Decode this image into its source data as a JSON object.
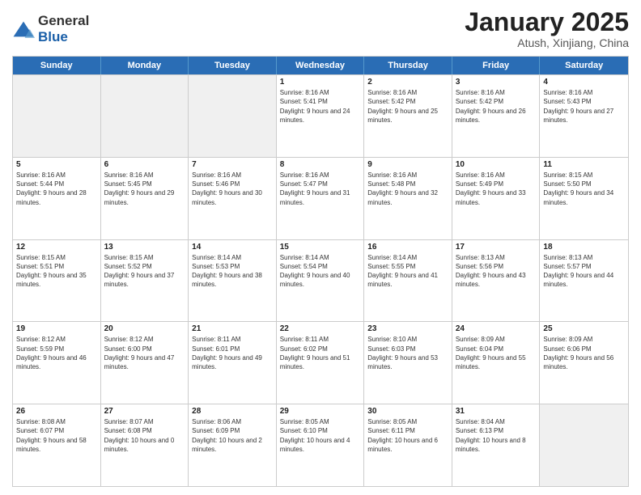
{
  "header": {
    "logo": {
      "general": "General",
      "blue": "Blue"
    },
    "month": "January 2025",
    "location": "Atush, Xinjiang, China"
  },
  "weekdays": [
    "Sunday",
    "Monday",
    "Tuesday",
    "Wednesday",
    "Thursday",
    "Friday",
    "Saturday"
  ],
  "rows": [
    [
      {
        "day": "",
        "sunrise": "",
        "sunset": "",
        "daylight": "",
        "shaded": true
      },
      {
        "day": "",
        "sunrise": "",
        "sunset": "",
        "daylight": "",
        "shaded": true
      },
      {
        "day": "",
        "sunrise": "",
        "sunset": "",
        "daylight": "",
        "shaded": true
      },
      {
        "day": "1",
        "sunrise": "Sunrise: 8:16 AM",
        "sunset": "Sunset: 5:41 PM",
        "daylight": "Daylight: 9 hours and 24 minutes."
      },
      {
        "day": "2",
        "sunrise": "Sunrise: 8:16 AM",
        "sunset": "Sunset: 5:42 PM",
        "daylight": "Daylight: 9 hours and 25 minutes."
      },
      {
        "day": "3",
        "sunrise": "Sunrise: 8:16 AM",
        "sunset": "Sunset: 5:42 PM",
        "daylight": "Daylight: 9 hours and 26 minutes."
      },
      {
        "day": "4",
        "sunrise": "Sunrise: 8:16 AM",
        "sunset": "Sunset: 5:43 PM",
        "daylight": "Daylight: 9 hours and 27 minutes."
      }
    ],
    [
      {
        "day": "5",
        "sunrise": "Sunrise: 8:16 AM",
        "sunset": "Sunset: 5:44 PM",
        "daylight": "Daylight: 9 hours and 28 minutes."
      },
      {
        "day": "6",
        "sunrise": "Sunrise: 8:16 AM",
        "sunset": "Sunset: 5:45 PM",
        "daylight": "Daylight: 9 hours and 29 minutes."
      },
      {
        "day": "7",
        "sunrise": "Sunrise: 8:16 AM",
        "sunset": "Sunset: 5:46 PM",
        "daylight": "Daylight: 9 hours and 30 minutes."
      },
      {
        "day": "8",
        "sunrise": "Sunrise: 8:16 AM",
        "sunset": "Sunset: 5:47 PM",
        "daylight": "Daylight: 9 hours and 31 minutes."
      },
      {
        "day": "9",
        "sunrise": "Sunrise: 8:16 AM",
        "sunset": "Sunset: 5:48 PM",
        "daylight": "Daylight: 9 hours and 32 minutes."
      },
      {
        "day": "10",
        "sunrise": "Sunrise: 8:16 AM",
        "sunset": "Sunset: 5:49 PM",
        "daylight": "Daylight: 9 hours and 33 minutes."
      },
      {
        "day": "11",
        "sunrise": "Sunrise: 8:15 AM",
        "sunset": "Sunset: 5:50 PM",
        "daylight": "Daylight: 9 hours and 34 minutes."
      }
    ],
    [
      {
        "day": "12",
        "sunrise": "Sunrise: 8:15 AM",
        "sunset": "Sunset: 5:51 PM",
        "daylight": "Daylight: 9 hours and 35 minutes."
      },
      {
        "day": "13",
        "sunrise": "Sunrise: 8:15 AM",
        "sunset": "Sunset: 5:52 PM",
        "daylight": "Daylight: 9 hours and 37 minutes."
      },
      {
        "day": "14",
        "sunrise": "Sunrise: 8:14 AM",
        "sunset": "Sunset: 5:53 PM",
        "daylight": "Daylight: 9 hours and 38 minutes."
      },
      {
        "day": "15",
        "sunrise": "Sunrise: 8:14 AM",
        "sunset": "Sunset: 5:54 PM",
        "daylight": "Daylight: 9 hours and 40 minutes."
      },
      {
        "day": "16",
        "sunrise": "Sunrise: 8:14 AM",
        "sunset": "Sunset: 5:55 PM",
        "daylight": "Daylight: 9 hours and 41 minutes."
      },
      {
        "day": "17",
        "sunrise": "Sunrise: 8:13 AM",
        "sunset": "Sunset: 5:56 PM",
        "daylight": "Daylight: 9 hours and 43 minutes."
      },
      {
        "day": "18",
        "sunrise": "Sunrise: 8:13 AM",
        "sunset": "Sunset: 5:57 PM",
        "daylight": "Daylight: 9 hours and 44 minutes."
      }
    ],
    [
      {
        "day": "19",
        "sunrise": "Sunrise: 8:12 AM",
        "sunset": "Sunset: 5:59 PM",
        "daylight": "Daylight: 9 hours and 46 minutes."
      },
      {
        "day": "20",
        "sunrise": "Sunrise: 8:12 AM",
        "sunset": "Sunset: 6:00 PM",
        "daylight": "Daylight: 9 hours and 47 minutes."
      },
      {
        "day": "21",
        "sunrise": "Sunrise: 8:11 AM",
        "sunset": "Sunset: 6:01 PM",
        "daylight": "Daylight: 9 hours and 49 minutes."
      },
      {
        "day": "22",
        "sunrise": "Sunrise: 8:11 AM",
        "sunset": "Sunset: 6:02 PM",
        "daylight": "Daylight: 9 hours and 51 minutes."
      },
      {
        "day": "23",
        "sunrise": "Sunrise: 8:10 AM",
        "sunset": "Sunset: 6:03 PM",
        "daylight": "Daylight: 9 hours and 53 minutes."
      },
      {
        "day": "24",
        "sunrise": "Sunrise: 8:09 AM",
        "sunset": "Sunset: 6:04 PM",
        "daylight": "Daylight: 9 hours and 55 minutes."
      },
      {
        "day": "25",
        "sunrise": "Sunrise: 8:09 AM",
        "sunset": "Sunset: 6:06 PM",
        "daylight": "Daylight: 9 hours and 56 minutes."
      }
    ],
    [
      {
        "day": "26",
        "sunrise": "Sunrise: 8:08 AM",
        "sunset": "Sunset: 6:07 PM",
        "daylight": "Daylight: 9 hours and 58 minutes."
      },
      {
        "day": "27",
        "sunrise": "Sunrise: 8:07 AM",
        "sunset": "Sunset: 6:08 PM",
        "daylight": "Daylight: 10 hours and 0 minutes."
      },
      {
        "day": "28",
        "sunrise": "Sunrise: 8:06 AM",
        "sunset": "Sunset: 6:09 PM",
        "daylight": "Daylight: 10 hours and 2 minutes."
      },
      {
        "day": "29",
        "sunrise": "Sunrise: 8:05 AM",
        "sunset": "Sunset: 6:10 PM",
        "daylight": "Daylight: 10 hours and 4 minutes."
      },
      {
        "day": "30",
        "sunrise": "Sunrise: 8:05 AM",
        "sunset": "Sunset: 6:11 PM",
        "daylight": "Daylight: 10 hours and 6 minutes."
      },
      {
        "day": "31",
        "sunrise": "Sunrise: 8:04 AM",
        "sunset": "Sunset: 6:13 PM",
        "daylight": "Daylight: 10 hours and 8 minutes."
      },
      {
        "day": "",
        "sunrise": "",
        "sunset": "",
        "daylight": "",
        "shaded": true
      }
    ]
  ]
}
